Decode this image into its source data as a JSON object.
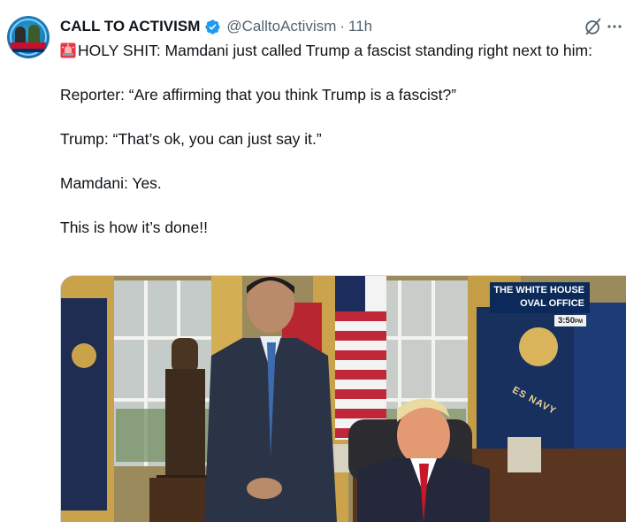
{
  "author": {
    "name": "CALL TO ACTIVISM",
    "handle": "@CalltoActivism",
    "separator": "·",
    "time": "11h",
    "verified": true,
    "avatar_text": "CALL TO ACTIVISM"
  },
  "actions": {
    "grok_icon": "slashed-circle-icon",
    "more_icon": "more-dots-icon"
  },
  "tweet": {
    "emoji": "rotating-light-emoji",
    "line1": "HOLY SHIT: Mamdani just called Trump a fascist standing right next to him:",
    "line2": "Reporter: “Are affirming that you think Trump is a fascist?”",
    "line3": "Trump: “That’s ok, you can just say it.”",
    "line4": "Mamdani: Yes.",
    "line5": "This is how it’s done!!"
  },
  "media": {
    "chyron_line1": "THE WHITE HOUSE",
    "chyron_line2": "OVAL OFFICE",
    "clock": "3:50",
    "clock_suffix": "PM",
    "flag_text": "ES NAVY"
  },
  "colors": {
    "text": "#0f1419",
    "secondary": "#536471",
    "verified": "#1d9bf0",
    "chyron": "#0b2a5a"
  }
}
